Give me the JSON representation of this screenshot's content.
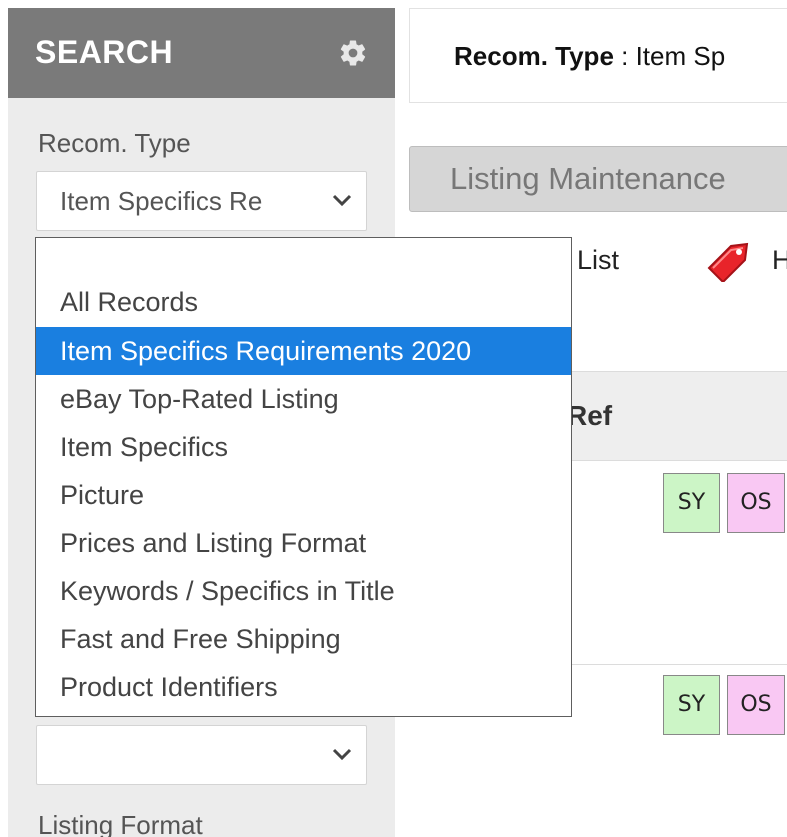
{
  "sidebar": {
    "title": "SEARCH",
    "recom_type_label": "Recom. Type",
    "recom_type_value": "Item Specifics Re",
    "second_select_value": "",
    "listing_format_label": "Listing Format"
  },
  "header": {
    "recom_type_key": "Recom. Type",
    "recom_type_sep": " : ",
    "recom_type_value": "Item Sp"
  },
  "toolbar": {
    "maintenance_label": "Listing Maintenance",
    "list_label": "List",
    "h_label": "H"
  },
  "table": {
    "header_ref": "Ref",
    "rows": [
      {
        "badge_sy": "SY",
        "badge_os": "OS"
      },
      {
        "badge_sy": "SY",
        "badge_os": "OS"
      }
    ]
  },
  "dropdown": {
    "options": [
      "",
      "All Records",
      "Item Specifics Requirements 2020",
      "eBay Top-Rated Listing",
      "Item Specifics",
      "Picture",
      "Prices and Listing Format",
      "Keywords / Specifics in Title",
      "Fast and Free Shipping",
      "Product Identifiers"
    ],
    "selected_option": "Item Specifics Requirements 2020"
  },
  "colors": {
    "header_bg": "#7a7a7a",
    "sidebar_bg": "#ececec",
    "selected_bg": "#1a7fe0",
    "badge_sy": "#ccf5c6",
    "badge_os": "#f9c8f3",
    "tag_red": "#e8242a"
  },
  "icons": {
    "settings": "gear-icon",
    "select_arrow": "chevron-down-icon",
    "tag": "price-tag-icon"
  }
}
